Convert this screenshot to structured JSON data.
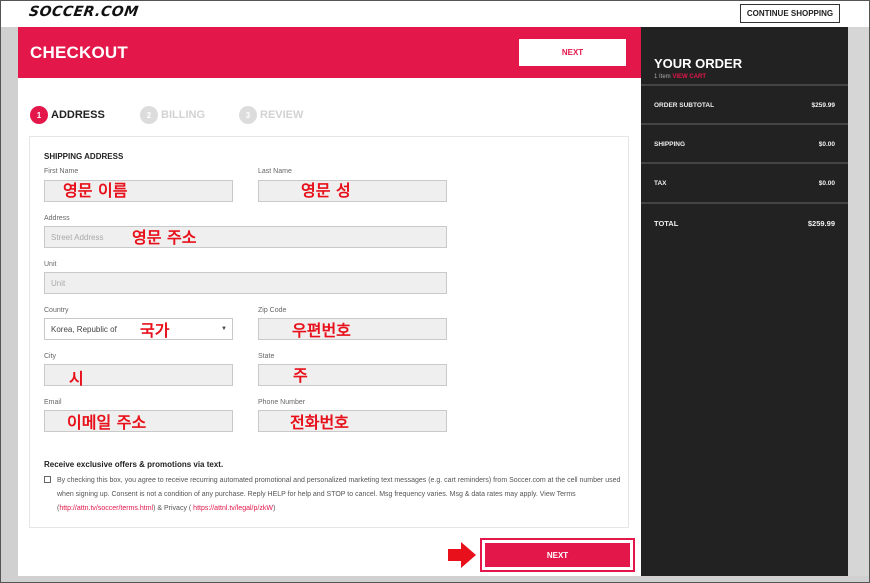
{
  "topbar": {
    "logo": "SOCCER.COM",
    "continue_label": "CONTINUE SHOPPING"
  },
  "header": {
    "title": "CHECKOUT",
    "next_label": "NEXT"
  },
  "steps": [
    {
      "num": "1",
      "label": "ADDRESS"
    },
    {
      "num": "2",
      "label": "BILLING"
    },
    {
      "num": "3",
      "label": "REVIEW"
    }
  ],
  "form": {
    "section_title": "SHIPPING ADDRESS",
    "first_name": {
      "label": "First Name",
      "value": "",
      "annotation": "영문 이름"
    },
    "last_name": {
      "label": "Last Name",
      "value": "",
      "annotation": "영문 성"
    },
    "address": {
      "label": "Address",
      "placeholder": "Street Address",
      "annotation": "영문 주소"
    },
    "unit": {
      "label": "Unit",
      "placeholder": "Unit"
    },
    "country": {
      "label": "Country",
      "value": "Korea, Republic of",
      "annotation": "국가"
    },
    "zip": {
      "label": "Zip Code",
      "value": "",
      "annotation": "우편번호"
    },
    "city": {
      "label": "City",
      "value": "",
      "annotation": "시"
    },
    "state": {
      "label": "State",
      "value": "",
      "annotation": "주"
    },
    "email": {
      "label": "Email",
      "value": "",
      "annotation": "이메일 주소"
    },
    "phone": {
      "label": "Phone Number",
      "value": "",
      "annotation": "전화번호"
    }
  },
  "promo": {
    "title": "Receive exclusive offers & promotions via text.",
    "text_part1": "By checking this box, you agree to receive recurring automated promotional and personalized marketing text messages (e.g. cart reminders) from Soccer.com at the cell number used when signing up. Consent is not a condition of any purchase. Reply HELP for help and STOP to cancel. Msg frequency varies. Msg & data rates may apply. View Terms (",
    "terms_link": "http://attn.tv/soccer/terms.html",
    "text_part2": ") & Privacy ( ",
    "privacy_link": "https://attnl.tv/legal/p/zkW",
    "text_part3": ")"
  },
  "bottom": {
    "next_label": "NEXT"
  },
  "sidebar": {
    "title": "YOUR ORDER",
    "items_count": "1 Item",
    "view_cart": "VIEW CART",
    "rows": [
      {
        "key": "ORDER SUBTOTAL",
        "value": "$259.99"
      },
      {
        "key": "SHIPPING",
        "value": "$0.00"
      },
      {
        "key": "TAX",
        "value": "$0.00"
      },
      {
        "key": "TOTAL",
        "value": "$259.99"
      }
    ]
  },
  "colors": {
    "brand_red": "#e3174a",
    "sidebar_bg": "#222222",
    "annotation_red": "#e8101a"
  }
}
